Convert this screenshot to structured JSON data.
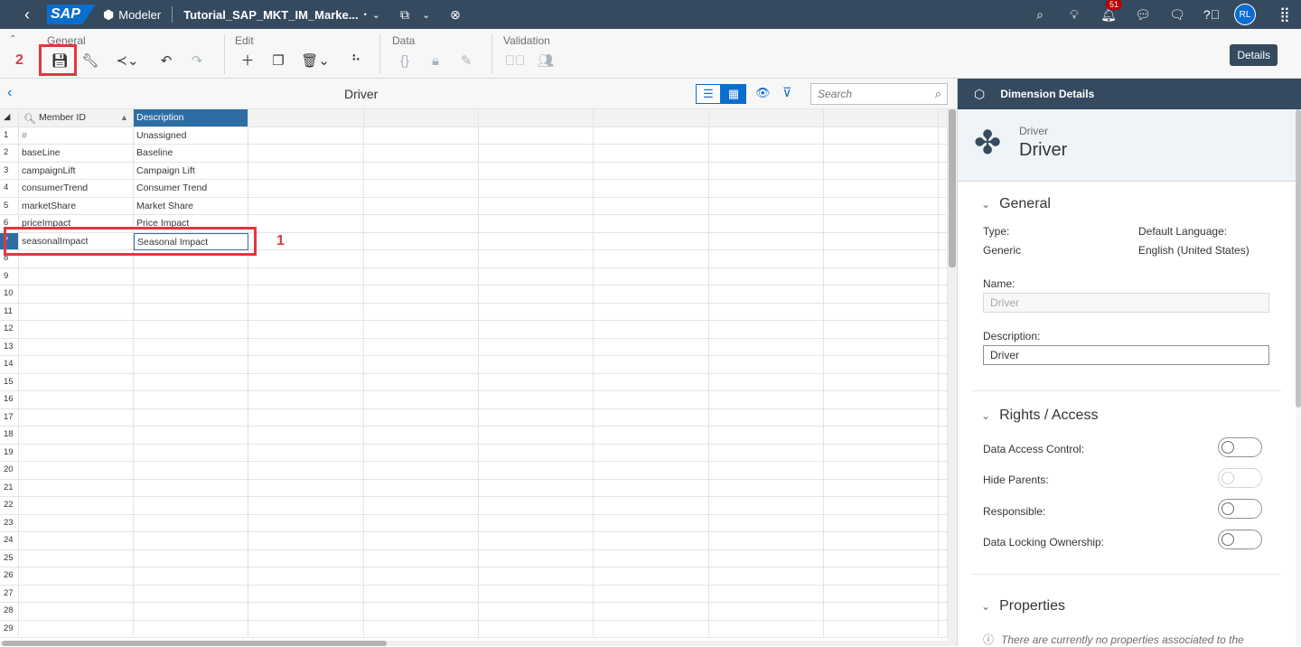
{
  "shell": {
    "logo": "SAP",
    "app_name": "Modeler",
    "file_name": "Tutorial_SAP_MKT_IM_Marke...",
    "unsaved_marker": "•",
    "notification_count": "51",
    "avatar_initials": "RL"
  },
  "toolbar": {
    "groups": {
      "general": "General",
      "edit": "Edit",
      "data": "Data",
      "validation": "Validation"
    },
    "details_label": "Details",
    "annotation_save": "2"
  },
  "grid": {
    "title": "Driver",
    "search_placeholder": "Search",
    "columns": [
      "Member ID",
      "Description"
    ],
    "rows": [
      {
        "n": "1",
        "id": "#",
        "desc": "Unassigned"
      },
      {
        "n": "2",
        "id": "baseLine",
        "desc": "Baseline"
      },
      {
        "n": "3",
        "id": "campaignLift",
        "desc": "Campaign Lift"
      },
      {
        "n": "4",
        "id": "consumerTrend",
        "desc": "Consumer Trend"
      },
      {
        "n": "5",
        "id": "marketShare",
        "desc": "Market Share"
      },
      {
        "n": "6",
        "id": "priceImpact",
        "desc": "Price Impact"
      },
      {
        "n": "7",
        "id": "seasonalImpact",
        "desc": "Seasonal Impact"
      },
      {
        "n": "8",
        "id": "",
        "desc": ""
      },
      {
        "n": "9",
        "id": "",
        "desc": ""
      },
      {
        "n": "10",
        "id": "",
        "desc": ""
      },
      {
        "n": "11",
        "id": "",
        "desc": ""
      },
      {
        "n": "12",
        "id": "",
        "desc": ""
      },
      {
        "n": "13",
        "id": "",
        "desc": ""
      },
      {
        "n": "14",
        "id": "",
        "desc": ""
      },
      {
        "n": "15",
        "id": "",
        "desc": ""
      },
      {
        "n": "16",
        "id": "",
        "desc": ""
      },
      {
        "n": "17",
        "id": "",
        "desc": ""
      },
      {
        "n": "18",
        "id": "",
        "desc": ""
      },
      {
        "n": "19",
        "id": "",
        "desc": ""
      },
      {
        "n": "20",
        "id": "",
        "desc": ""
      },
      {
        "n": "21",
        "id": "",
        "desc": ""
      },
      {
        "n": "22",
        "id": "",
        "desc": ""
      },
      {
        "n": "23",
        "id": "",
        "desc": ""
      },
      {
        "n": "24",
        "id": "",
        "desc": ""
      },
      {
        "n": "25",
        "id": "",
        "desc": ""
      },
      {
        "n": "26",
        "id": "",
        "desc": ""
      },
      {
        "n": "27",
        "id": "",
        "desc": ""
      },
      {
        "n": "28",
        "id": "",
        "desc": ""
      },
      {
        "n": "29",
        "id": "",
        "desc": ""
      }
    ],
    "selected_row": "7",
    "annotation_row": "1"
  },
  "panel": {
    "header": "Dimension Details",
    "object_type": "Driver",
    "object_name": "Driver",
    "general": {
      "title": "General",
      "type_label": "Type:",
      "type_value": "Generic",
      "lang_label": "Default Language:",
      "lang_value": "English (United States)",
      "name_label": "Name:",
      "name_value": "Driver",
      "desc_label": "Description:",
      "desc_value": "Driver"
    },
    "rights": {
      "title": "Rights / Access",
      "items": [
        {
          "label": "Data Access Control:",
          "on": false,
          "enabled": true
        },
        {
          "label": "Hide Parents:",
          "on": false,
          "enabled": false
        },
        {
          "label": "Responsible:",
          "on": false,
          "enabled": true
        },
        {
          "label": "Data Locking Ownership:",
          "on": false,
          "enabled": true
        }
      ]
    },
    "properties": {
      "title": "Properties",
      "note": "There are currently no properties associated to the"
    }
  },
  "colors": {
    "shell": "#354a5f",
    "accent": "#0a6ed1",
    "selection": "#2e6da4",
    "annotation": "#e2373f"
  }
}
